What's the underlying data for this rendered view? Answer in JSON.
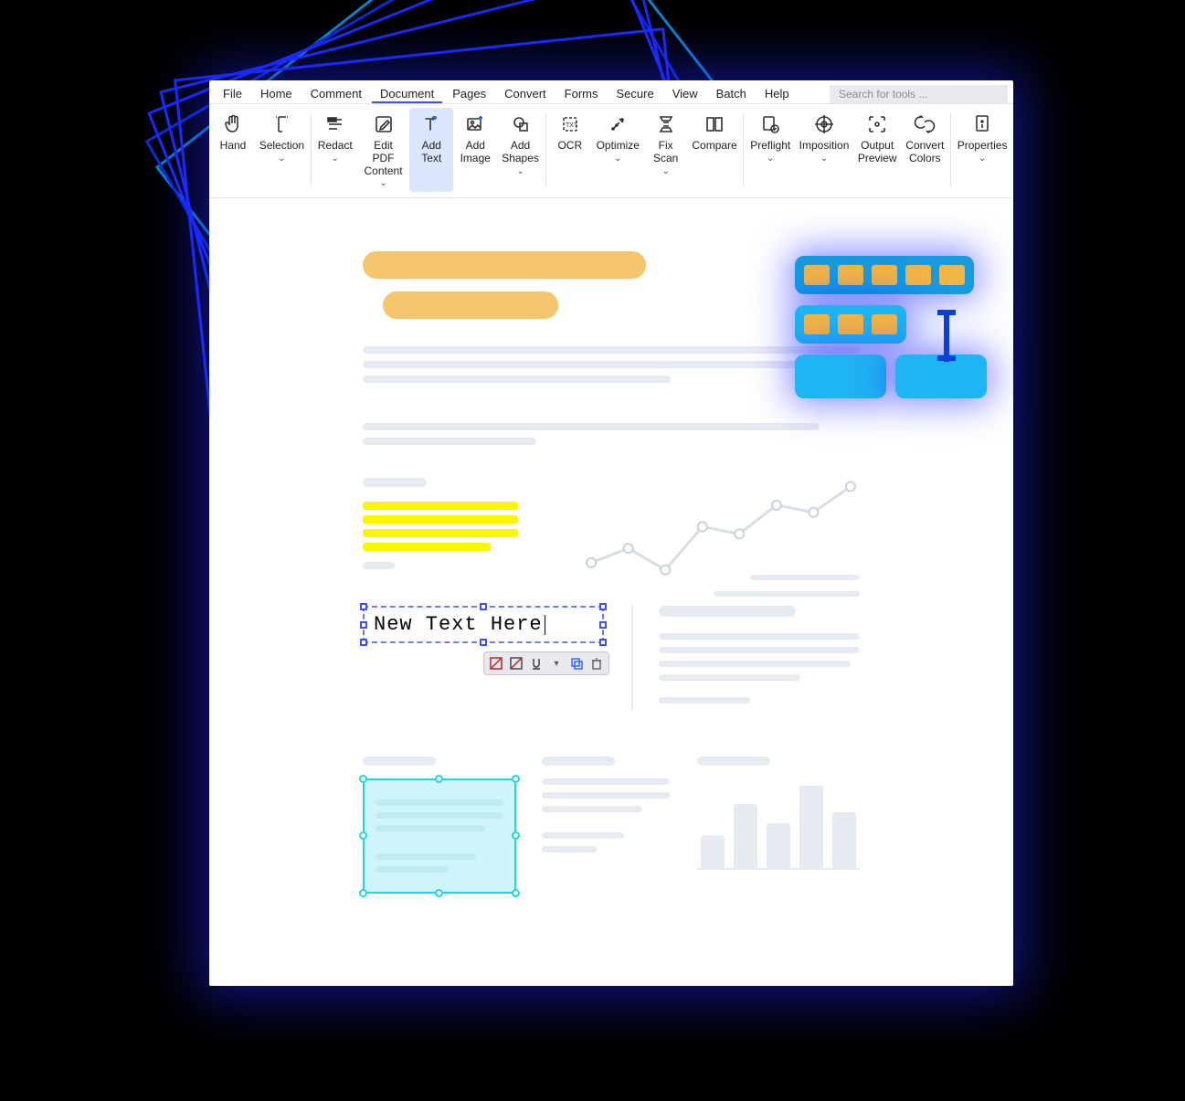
{
  "menubar": {
    "items": [
      "File",
      "Home",
      "Comment",
      "Document",
      "Pages",
      "Convert",
      "Forms",
      "Secure",
      "View",
      "Batch",
      "Help"
    ],
    "active_index": 3,
    "search_placeholder": "Search for tools ..."
  },
  "ribbon": [
    {
      "label": "Hand",
      "icon": "hand",
      "dropdown": false
    },
    {
      "label": "Selection",
      "icon": "selection",
      "dropdown": true
    },
    {
      "sep": true
    },
    {
      "label": "Redact",
      "icon": "redact",
      "dropdown": true
    },
    {
      "label": "Edit PDF\nContent",
      "icon": "edit",
      "dropdown": true
    },
    {
      "label": "Add\nText",
      "icon": "addtext",
      "dropdown": false,
      "selected": true
    },
    {
      "label": "Add\nImage",
      "icon": "addimage",
      "dropdown": false
    },
    {
      "label": "Add\nShapes",
      "icon": "addshapes",
      "dropdown": true
    },
    {
      "sep": true
    },
    {
      "label": "OCR",
      "icon": "ocr",
      "dropdown": false
    },
    {
      "label": "Optimize",
      "icon": "optimize",
      "dropdown": true
    },
    {
      "label": "Fix\nScan",
      "icon": "fixscan",
      "dropdown": true
    },
    {
      "label": "Compare",
      "icon": "compare",
      "dropdown": false
    },
    {
      "sep": true
    },
    {
      "label": "Preflight",
      "icon": "preflight",
      "dropdown": true
    },
    {
      "label": "Imposition",
      "icon": "imposition",
      "dropdown": true
    },
    {
      "label": "Output\nPreview",
      "icon": "outputpreview",
      "dropdown": false
    },
    {
      "label": "Convert\nColors",
      "icon": "convertcolors",
      "dropdown": false
    },
    {
      "sep": true
    },
    {
      "label": "Properties",
      "icon": "properties",
      "dropdown": true
    }
  ],
  "edit_text": "New Text Here",
  "chart_data": {
    "type": "line",
    "x": [
      0,
      1,
      2,
      3,
      4,
      5,
      6,
      7
    ],
    "values": [
      35,
      45,
      30,
      60,
      55,
      75,
      70,
      88
    ]
  },
  "bar_chart": {
    "type": "bar",
    "values": [
      40,
      78,
      55,
      100,
      68
    ]
  },
  "colors": {
    "accent": "#3c50ff",
    "highlight": "#f4c56a",
    "yellow": "#faf600",
    "cyan": "#20d6e6"
  }
}
